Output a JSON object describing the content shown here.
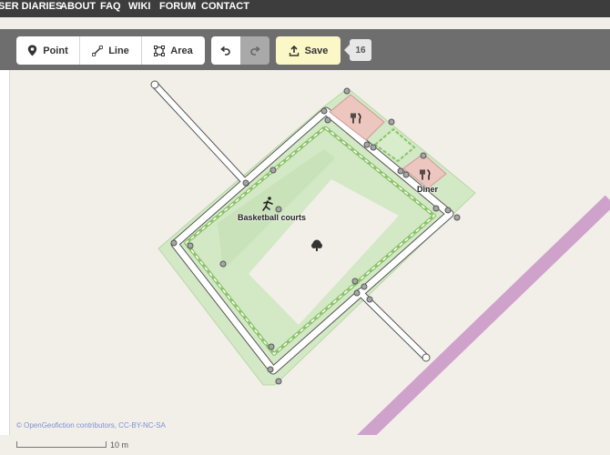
{
  "nav": {
    "items": [
      "SER DIARIES",
      "ABOUT",
      "FAQ",
      "WIKI",
      "FORUM",
      "CONTACT"
    ]
  },
  "toolbar": {
    "point_label": "Point",
    "line_label": "Line",
    "area_label": "Area",
    "save_label": "Save",
    "save_count": "16"
  },
  "map": {
    "labels": {
      "basketball": "Basketball courts",
      "diner": "Diner"
    },
    "colors": {
      "park_fill": "#cfe7c1",
      "pitch_fill": "#f0eee8",
      "restaurant_fill": "#edc6bf",
      "road": "#ffffff",
      "road_casing": "#444444",
      "railway": "#c994c6",
      "dashed_boundary": "#8cc36a"
    },
    "attribution": "© OpenGeofiction contributors, CC-BY-NC-SA",
    "scale_label": "10 m"
  }
}
